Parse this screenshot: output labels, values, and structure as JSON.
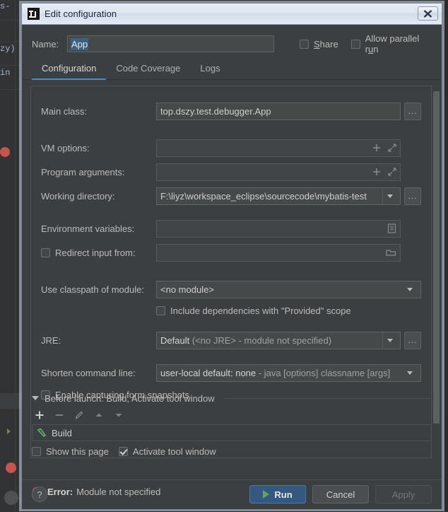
{
  "window": {
    "title": "Edit configuration",
    "app_icon": "intellij-idea-icon",
    "close_icon": "close-icon"
  },
  "name_row": {
    "label": "Name:",
    "value": "App",
    "share_label": "Share",
    "allow_parallel_label": "Allow parallel run"
  },
  "tabs": [
    {
      "label": "Configuration",
      "active": true
    },
    {
      "label": "Code Coverage",
      "active": false
    },
    {
      "label": "Logs",
      "active": false
    }
  ],
  "form": {
    "main_class": {
      "label": "Main class:",
      "value": "top.dszy.test.debugger.App",
      "browse": "..."
    },
    "vm_options": {
      "label": "VM options:",
      "value": ""
    },
    "program_arguments": {
      "label": "Program arguments:",
      "value": ""
    },
    "working_directory": {
      "label": "Working directory:",
      "value": "F:\\liyz\\workspace_eclipse\\sourcecode\\mybatis-test",
      "browse": "..."
    },
    "environment_variables": {
      "label": "Environment variables:",
      "value": ""
    },
    "redirect_input": {
      "label": "Redirect input from:",
      "value": "",
      "checked": false
    },
    "use_classpath_of_module": {
      "label": "Use classpath of module:",
      "value": "<no module>"
    },
    "include_provided": {
      "label": "Include dependencies with \"Provided\" scope",
      "checked": false
    },
    "jre": {
      "label": "JRE:",
      "value_strong": "Default",
      "value_dim": "(<no JRE> - module not specified)",
      "browse": "..."
    },
    "shorten_command_line": {
      "label": "Shorten command line:",
      "value_strong": "user-local default: none",
      "value_dim": "- java [options] classname [args]"
    },
    "enable_snapshots": {
      "label": "Enable capturing form snapshots",
      "checked": false,
      "mnemonic": "E"
    }
  },
  "before_launch": {
    "header": "Before launch: Build, Activate tool window",
    "toolbar": [
      {
        "name": "add-icon",
        "glyph": "+",
        "enabled": true
      },
      {
        "name": "remove-icon",
        "glyph": "−",
        "enabled": false
      },
      {
        "name": "edit-pencil-icon",
        "glyph": "✎",
        "enabled": false
      },
      {
        "name": "move-up-icon",
        "glyph": "▲",
        "enabled": false
      },
      {
        "name": "move-down-icon",
        "glyph": "▼",
        "enabled": false
      }
    ],
    "items": [
      {
        "label": "Build",
        "icon": "build-hammer-icon"
      }
    ],
    "show_this_page": {
      "label": "Show this page",
      "checked": false
    },
    "activate_tool_window": {
      "label": "Activate tool window",
      "checked": true
    }
  },
  "error": {
    "icon": "error-icon",
    "word": "Error:",
    "message": "Module not specified"
  },
  "footer": {
    "help": "?",
    "run": "Run",
    "cancel": "Cancel",
    "apply": "Apply"
  },
  "background": {
    "fragments": [
      "s-",
      "zy)",
      "in"
    ]
  },
  "colors": {
    "dialog_bg": "#3c3f41",
    "field_bg": "#45494a",
    "accent_blue": "#4a88c7",
    "run_blue": "#365880",
    "error_red": "#c75450",
    "green": "#59a869",
    "selection_blue": "#3d6185"
  }
}
